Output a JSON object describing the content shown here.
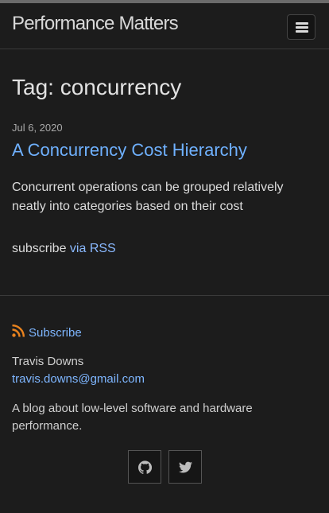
{
  "header": {
    "site_title": "Performance Matters",
    "menu_icon": "hamburger-menu-icon"
  },
  "page": {
    "heading": "Tag: concurrency"
  },
  "posts": [
    {
      "date": "Jul 6, 2020",
      "title": "A Concurrency Cost Hierarchy",
      "excerpt": "Concurrent operations can be grouped relatively neatly into categories based on their cost"
    }
  ],
  "subscribe": {
    "prefix": "subscribe ",
    "link_text": "via RSS"
  },
  "footer": {
    "subscribe_label": "Subscribe",
    "subscribe_icon": "rss-icon",
    "author_name": "Travis Downs",
    "author_email": "travis.downs@gmail.com",
    "description": "A blog about low-level software and hardware performance.",
    "social": [
      {
        "icon": "github-icon"
      },
      {
        "icon": "twitter-icon"
      }
    ]
  },
  "colors": {
    "background": "#1c1c1c",
    "link": "#6fb1ff",
    "text": "#dddddd"
  }
}
